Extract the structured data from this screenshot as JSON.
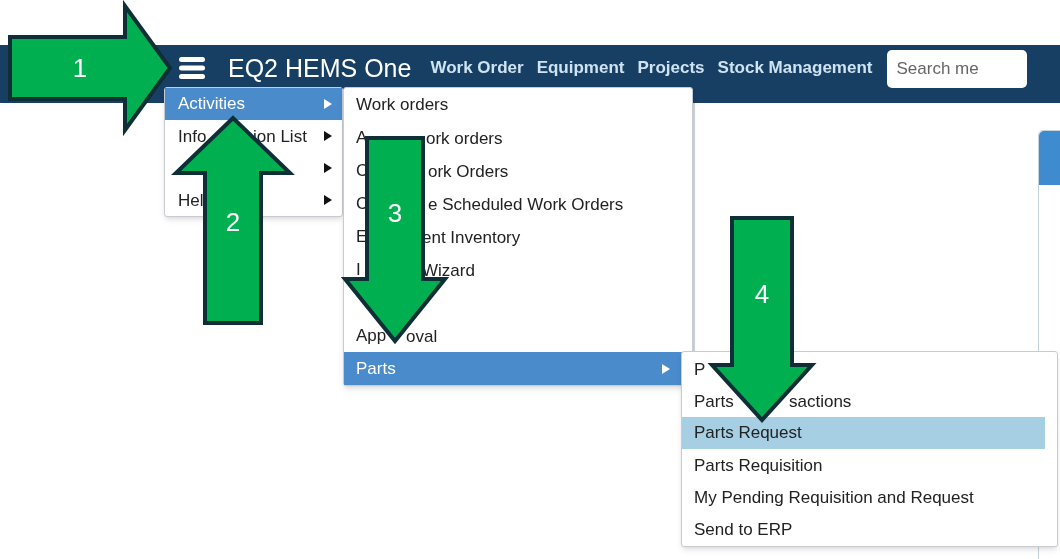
{
  "navbar": {
    "title": "EQ2 HEMS One",
    "links": [
      "Work Order",
      "Equipment",
      "Projects",
      "Stock Management"
    ],
    "search": {
      "placeholder": "Search me"
    }
  },
  "main_menu": [
    {
      "parts": [
        "Activities"
      ],
      "selected": true,
      "submenu": true
    },
    {
      "parts": [
        "Info",
        "ion List"
      ],
      "selected": false,
      "submenu": true
    },
    {
      "submenu": true
    },
    {
      "parts": [
        "Hel"
      ],
      "selected": false,
      "submenu": true
    }
  ],
  "activities_menu": [
    {
      "parts": [
        "Work orders"
      ],
      "selected": false
    },
    {
      "parts": [
        "A",
        "ork orders"
      ],
      "selected": false
    },
    {
      "parts": [
        "C",
        "ork Orders"
      ],
      "selected": false
    },
    {
      "parts": [
        "C",
        "e Scheduled Work Orders"
      ],
      "selected": false
    },
    {
      "parts": [
        "E",
        "ent Inventory"
      ],
      "selected": false
    },
    {
      "parts": [
        "I",
        "Wizard"
      ],
      "selected": false
    },
    {
      "parts": [
        "App",
        "oval"
      ],
      "selected": false
    },
    {
      "parts": [
        "Parts"
      ],
      "selected": true,
      "submenu": true
    }
  ],
  "parts_menu": [
    {
      "parts": [
        "P"
      ],
      "selected": false
    },
    {
      "parts": [
        "Parts",
        "sactions"
      ],
      "selected": false
    },
    {
      "parts": [
        "Parts Request"
      ],
      "selected": true
    },
    {
      "parts": [
        "Parts Requisition"
      ],
      "selected": false
    },
    {
      "parts": [
        "My Pending Requisition and Request"
      ],
      "selected": false
    },
    {
      "parts": [
        "Send to ERP"
      ],
      "selected": false
    }
  ],
  "callouts": [
    {
      "number": "1"
    },
    {
      "number": "2"
    },
    {
      "number": "3"
    },
    {
      "number": "4"
    }
  ]
}
